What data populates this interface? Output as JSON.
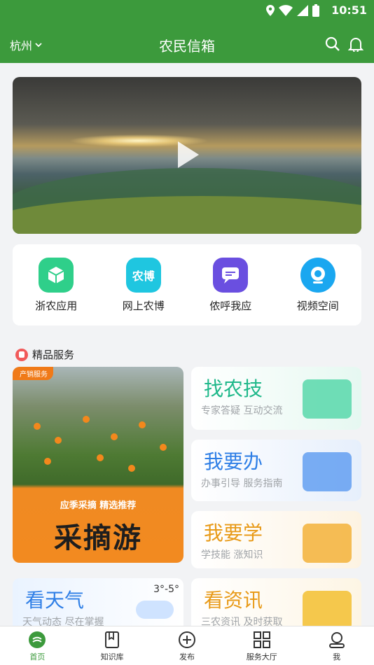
{
  "status_bar": {
    "time": "10:51"
  },
  "header": {
    "city": "杭州",
    "title": "农民信箱"
  },
  "quick_links": [
    {
      "label": "浙农应用",
      "icon": "cube-icon",
      "color": "#2fcf8a"
    },
    {
      "label": "网上农博",
      "icon": "nongbo-icon",
      "text": "农博",
      "color": "#1fc6e0"
    },
    {
      "label": "侬呼我应",
      "icon": "chat-icon",
      "color": "#6a4fe0"
    },
    {
      "label": "视频空间",
      "icon": "camera-icon",
      "color": "#1aa7f0"
    }
  ],
  "featured": {
    "title": "精品服务",
    "promo": {
      "tag": "产销服务",
      "subtitle": "应季采摘 精选推荐",
      "headline": "采摘游"
    },
    "cards": [
      {
        "title": "找农技",
        "subtitle": "专家答疑 互动交流",
        "color": "#1fb88a"
      },
      {
        "title": "我要办",
        "subtitle": "办事引导 服务指南",
        "color": "#2f7fe6"
      },
      {
        "title": "我要学",
        "subtitle": "学技能 涨知识",
        "color": "#e89a18"
      },
      {
        "title": "看天气",
        "subtitle": "天气动态 尽在掌握",
        "extra": "3°-5°",
        "color": "#2f7fe6"
      },
      {
        "title": "看资讯",
        "subtitle": "三农资讯 及时获取",
        "color": "#e89a18"
      }
    ]
  },
  "tabs": [
    {
      "label": "首页",
      "active": true
    },
    {
      "label": "知识库"
    },
    {
      "label": "发布"
    },
    {
      "label": "服务大厅"
    },
    {
      "label": "我"
    }
  ]
}
